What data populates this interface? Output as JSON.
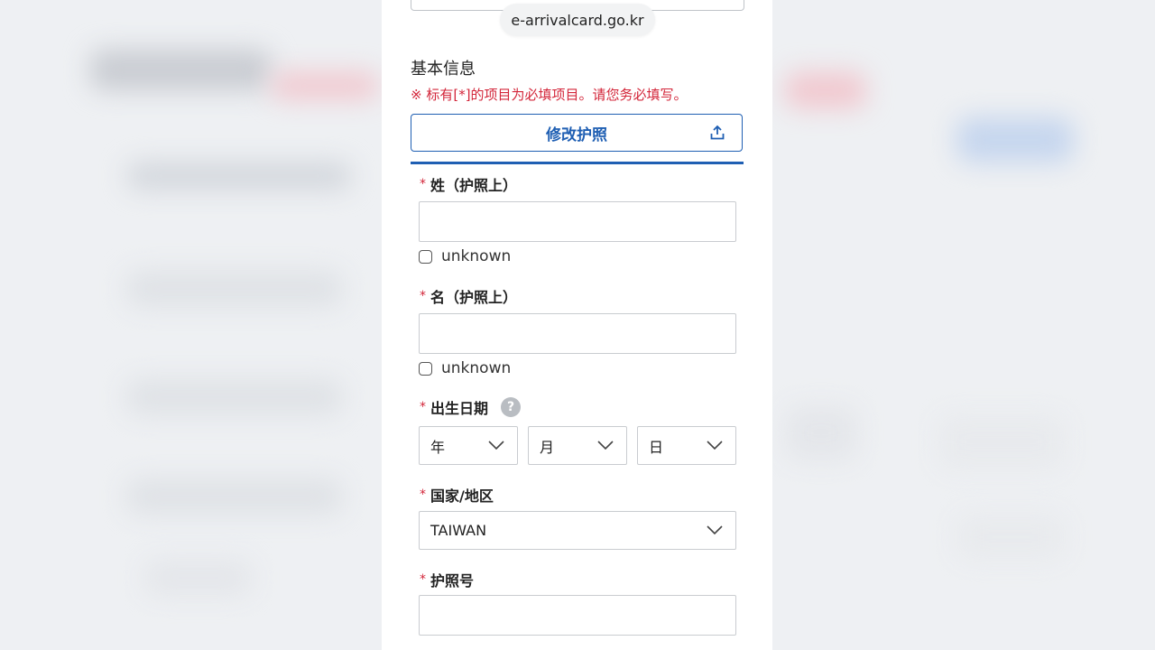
{
  "browser": {
    "url": "e-arrivalcard.go.kr"
  },
  "form": {
    "section_title": "基本信息",
    "required_notice": "※ 标有[*]的项目为必填项目。请您务必填写。",
    "modify_passport_label": "修改护照",
    "required_mark": "*",
    "surname": {
      "label": "姓（护照上）",
      "value": "",
      "unknown_label": "unknown"
    },
    "given_name": {
      "label": "名（护照上）",
      "value": "",
      "unknown_label": "unknown"
    },
    "birth_date": {
      "label": "出生日期",
      "help_glyph": "?",
      "year_placeholder": "年",
      "month_placeholder": "月",
      "day_placeholder": "日"
    },
    "country": {
      "label": "国家/地区",
      "value": "TAIWAN"
    },
    "passport_no": {
      "label": "护照号",
      "value": ""
    }
  },
  "colors": {
    "accent_blue": "#1f5fb3",
    "required_red": "#d3263a",
    "border_gray": "#c9ccd0"
  }
}
